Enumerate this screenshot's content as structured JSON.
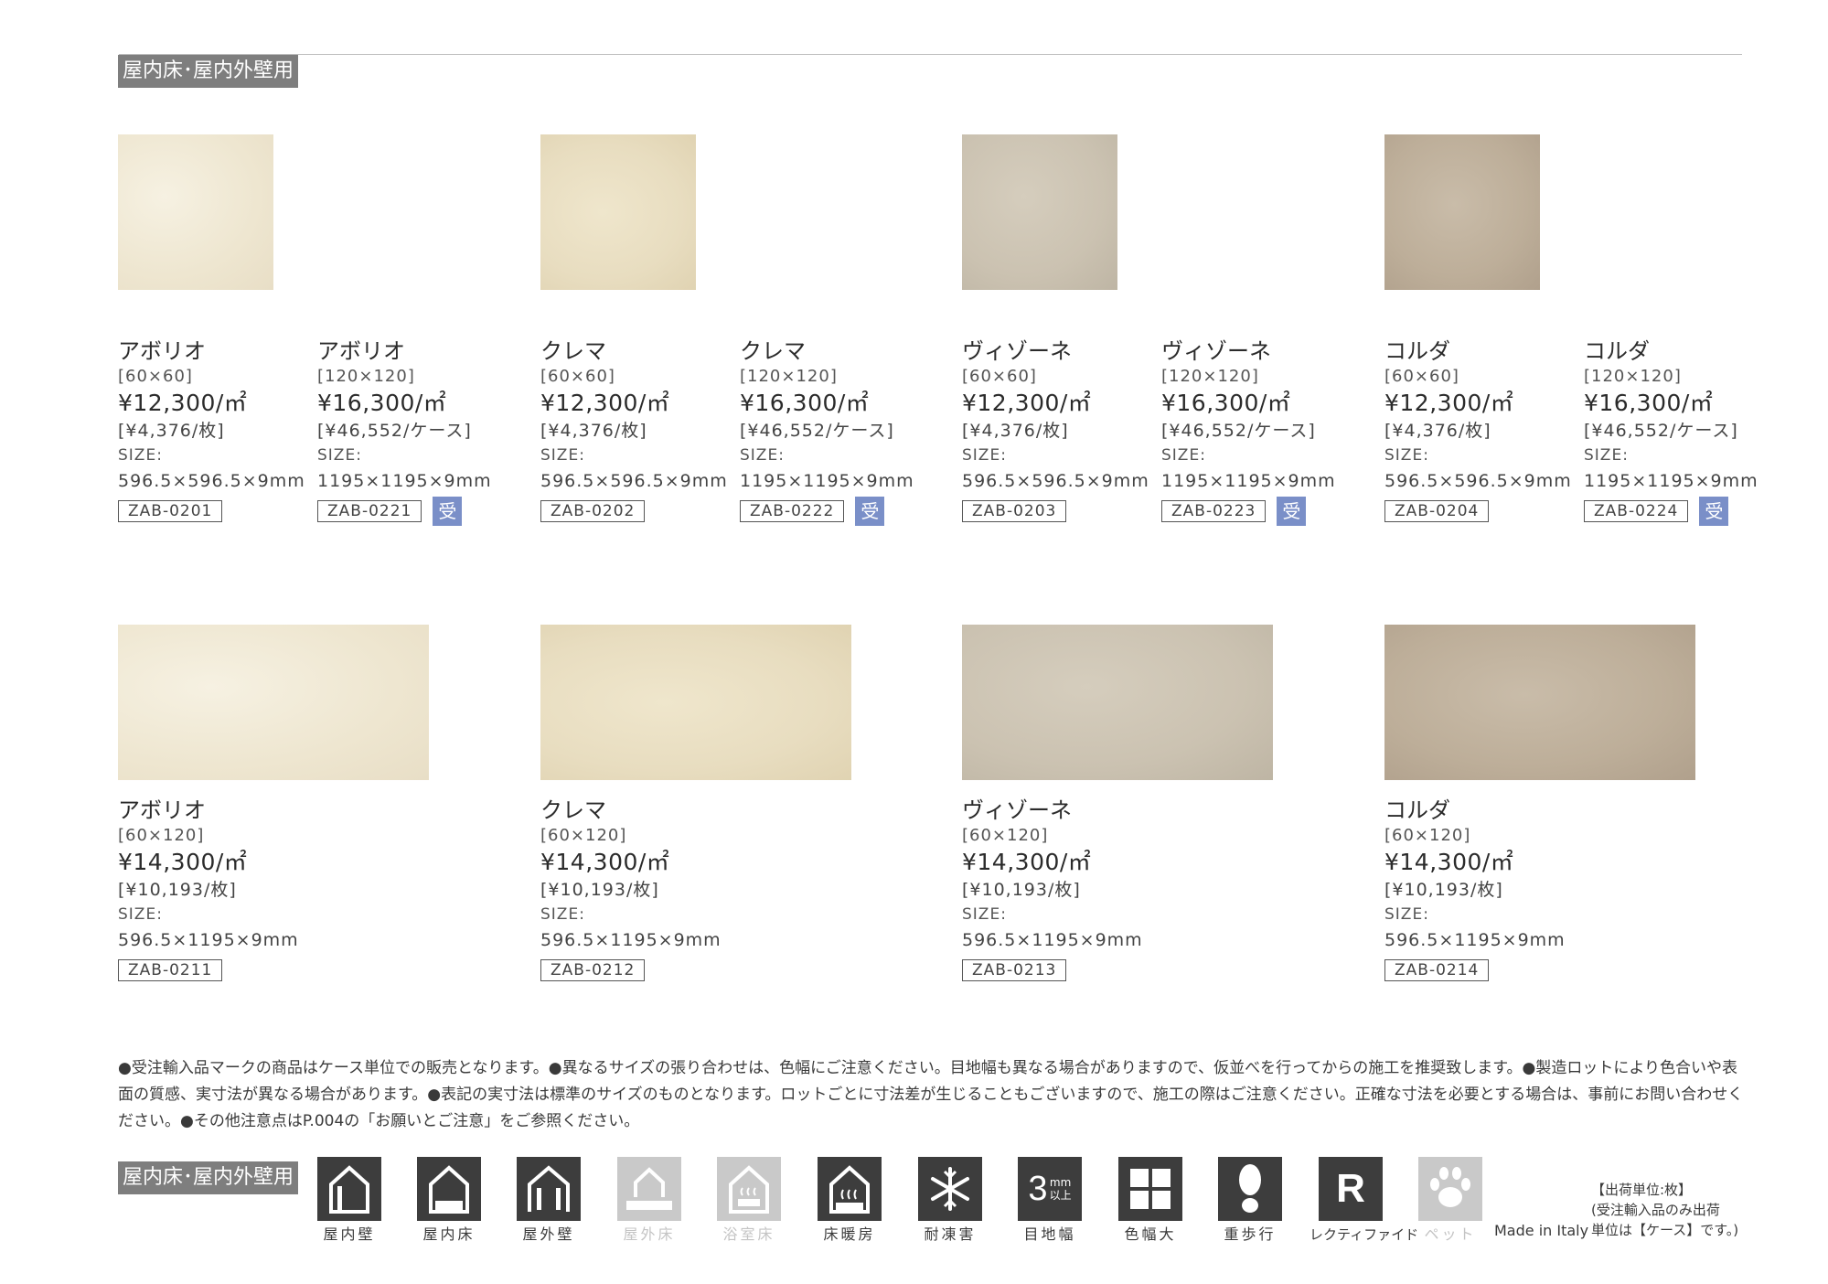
{
  "section_label": "屋内床･屋内外壁用",
  "row1": [
    {
      "name": "アボリオ",
      "dim": "[60×60]",
      "price": "¥12,300/㎡",
      "unit": "[¥4,376/枚]",
      "size_label": "SIZE:",
      "size": "596.5×596.5×9mm",
      "code": "ZAB-0201"
    },
    {
      "name": "アボリオ",
      "dim": "[120×120]",
      "price": "¥16,300/㎡",
      "unit": "[¥46,552/ケース]",
      "size_label": "SIZE:",
      "size": "1195×1195×9mm",
      "code": "ZAB-0221",
      "badge": "受"
    },
    {
      "name": "クレマ",
      "dim": "[60×60]",
      "price": "¥12,300/㎡",
      "unit": "[¥4,376/枚]",
      "size_label": "SIZE:",
      "size": "596.5×596.5×9mm",
      "code": "ZAB-0202"
    },
    {
      "name": "クレマ",
      "dim": "[120×120]",
      "price": "¥16,300/㎡",
      "unit": "[¥46,552/ケース]",
      "size_label": "SIZE:",
      "size": "1195×1195×9mm",
      "code": "ZAB-0222",
      "badge": "受"
    },
    {
      "name": "ヴィゾーネ",
      "dim": "[60×60]",
      "price": "¥12,300/㎡",
      "unit": "[¥4,376/枚]",
      "size_label": "SIZE:",
      "size": "596.5×596.5×9mm",
      "code": "ZAB-0203"
    },
    {
      "name": "ヴィゾーネ",
      "dim": "[120×120]",
      "price": "¥16,300/㎡",
      "unit": "[¥46,552/ケース]",
      "size_label": "SIZE:",
      "size": "1195×1195×9mm",
      "code": "ZAB-0223",
      "badge": "受"
    },
    {
      "name": "コルダ",
      "dim": "[60×60]",
      "price": "¥12,300/㎡",
      "unit": "[¥4,376/枚]",
      "size_label": "SIZE:",
      "size": "596.5×596.5×9mm",
      "code": "ZAB-0204"
    },
    {
      "name": "コルダ",
      "dim": "[120×120]",
      "price": "¥16,300/㎡",
      "unit": "[¥46,552/ケース]",
      "size_label": "SIZE:",
      "size": "1195×1195×9mm",
      "code": "ZAB-0224",
      "badge": "受"
    }
  ],
  "row2": [
    {
      "name": "アボリオ",
      "dim": "[60×120]",
      "price": "¥14,300/㎡",
      "unit": "[¥10,193/枚]",
      "size_label": "SIZE:",
      "size": "596.5×1195×9mm",
      "code": "ZAB-0211"
    },
    {
      "name": "クレマ",
      "dim": "[60×120]",
      "price": "¥14,300/㎡",
      "unit": "[¥10,193/枚]",
      "size_label": "SIZE:",
      "size": "596.5×1195×9mm",
      "code": "ZAB-0212"
    },
    {
      "name": "ヴィゾーネ",
      "dim": "[60×120]",
      "price": "¥14,300/㎡",
      "unit": "[¥10,193/枚]",
      "size_label": "SIZE:",
      "size": "596.5×1195×9mm",
      "code": "ZAB-0213"
    },
    {
      "name": "コルダ",
      "dim": "[60×120]",
      "price": "¥14,300/㎡",
      "unit": "[¥10,193/枚]",
      "size_label": "SIZE:",
      "size": "596.5×1195×9mm",
      "code": "ZAB-0214"
    }
  ],
  "notes": "●受注輸入品マークの商品はケース単位での販売となります。●異なるサイズの張り合わせは、色幅にご注意ください。目地幅も異なる場合がありますので、仮並べを行ってからの施工を推奨致します。●製造ロットにより色合いや表面の質感、実寸法が異なる場合があります。●表記の実寸法は標準のサイズのものとなります。ロットごとに寸法差が生じることもございますので、施工の際はご注意ください。正確な寸法を必要とする場合は、事前にお問い合わせください。●その他注意点はP.004の「お願いとご注意」をご参照ください。",
  "icons": [
    {
      "label": "屋内壁",
      "name": "indoor-wall-icon",
      "active": true
    },
    {
      "label": "屋内床",
      "name": "indoor-floor-icon",
      "active": true
    },
    {
      "label": "屋外壁",
      "name": "outdoor-wall-icon",
      "active": true
    },
    {
      "label": "屋外床",
      "name": "outdoor-floor-icon",
      "active": false
    },
    {
      "label": "浴室床",
      "name": "bathroom-floor-icon",
      "active": false
    },
    {
      "label": "床暖房",
      "name": "floor-heating-icon",
      "active": true
    },
    {
      "label": "耐凍害",
      "name": "frost-resistant-icon",
      "active": true
    },
    {
      "label": "目地幅",
      "name": "joint-width-icon",
      "active": true,
      "value": "3",
      "unit_top": "mm",
      "unit_bottom": "以上"
    },
    {
      "label": "色幅大",
      "name": "color-variation-icon",
      "active": true
    },
    {
      "label": "重歩行",
      "name": "heavy-traffic-icon",
      "active": true
    },
    {
      "label": "レクティファイド",
      "name": "rectified-icon",
      "active": true,
      "glyph": "R"
    },
    {
      "label": "ペット",
      "name": "pet-icon",
      "active": false
    }
  ],
  "made_in": "Made in Italy",
  "shipping_note": [
    "【出荷単位:枚】",
    "(受注輸入品のみ出荷",
    "単位は【ケース】です。)"
  ]
}
